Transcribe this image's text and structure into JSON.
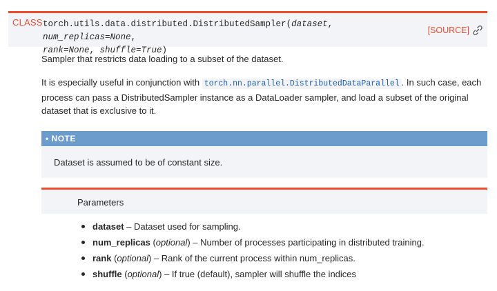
{
  "signature": {
    "class_label": "CLASS",
    "qualified_name": "torch.utils.data.distributed.DistributedSampler",
    "open_paren": "(",
    "p1": "dataset",
    "sep1": ", ",
    "p2": "num_replicas=None",
    "sep2": ",",
    "p3": "rank=None",
    "sep3": ", ",
    "p4": "shuffle=True",
    "close_paren": ")",
    "source_label": "[SOURCE]",
    "link_icon": "link-icon"
  },
  "description": {
    "line1": "Sampler that restricts data loading to a subset of the dataset.",
    "p2_before": "It is especially useful in conjunction with ",
    "p2_code": "torch.nn.parallel.DistributedDataParallel",
    "p2_after": ". In such case, each process can pass a DistributedSampler instance as a DataLoader sampler, and load a subset of the original dataset that is exclusive to it."
  },
  "note": {
    "header": "• NOTE",
    "body": "Dataset is assumed to be of constant size."
  },
  "parameters": {
    "title": "Parameters",
    "items": [
      {
        "name": "dataset",
        "optional": "",
        "desc": " – Dataset used for sampling."
      },
      {
        "name": "num_replicas",
        "optional": "optional",
        "desc": " – Number of processes participating in distributed training."
      },
      {
        "name": "rank",
        "optional": "optional",
        "desc": " – Rank of the current process within num_replicas."
      },
      {
        "name": "shuffle",
        "optional": "optional",
        "desc": " – If true (default), sampler will shuffle the indices"
      }
    ]
  },
  "colors": {
    "accent": "#ee4c2c",
    "note_header": "#6c9ccc",
    "panel_bg": "#f3f4f7",
    "code_text": "#1f5fb0"
  }
}
